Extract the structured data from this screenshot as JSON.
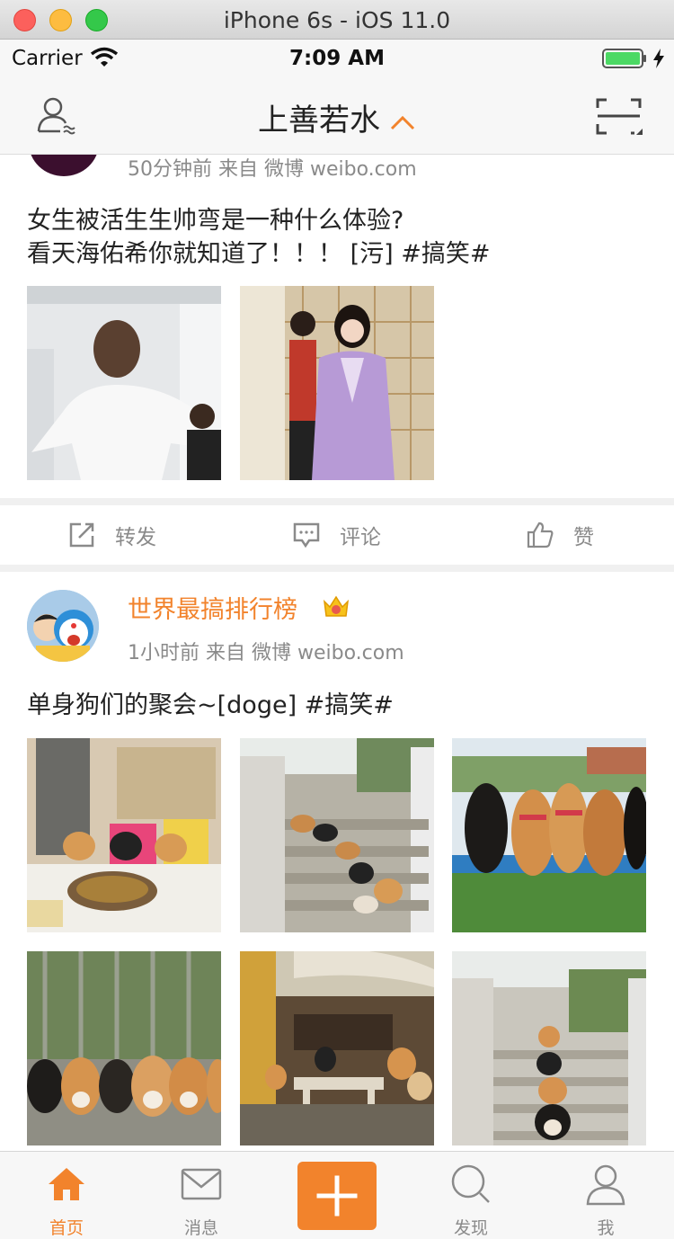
{
  "simulator": {
    "title": "iPhone 6s - iOS 11.0"
  },
  "status": {
    "carrier": "Carrier",
    "time": "7:09 AM"
  },
  "nav": {
    "title": "上善若水"
  },
  "posts": [
    {
      "meta": "50分钟前   来自 微博 weibo.com",
      "text_line1": "女生被活生生帅弯是一种什么体验?",
      "text_line2": "看天海佑希你就知道了！！！ [污] #搞笑#",
      "actions": {
        "repost": "转发",
        "comment": "评论",
        "like": "赞"
      }
    },
    {
      "username": "世界最搞排行榜",
      "meta": "1小时前   来自 微博 weibo.com",
      "text": "单身狗们的聚会~[doge] #搞笑#"
    }
  ],
  "tabs": {
    "home": "首页",
    "messages": "消息",
    "discover": "发现",
    "me": "我"
  },
  "colors": {
    "accent": "#f2832c",
    "text": "#222222",
    "meta": "#8a8a8a"
  }
}
